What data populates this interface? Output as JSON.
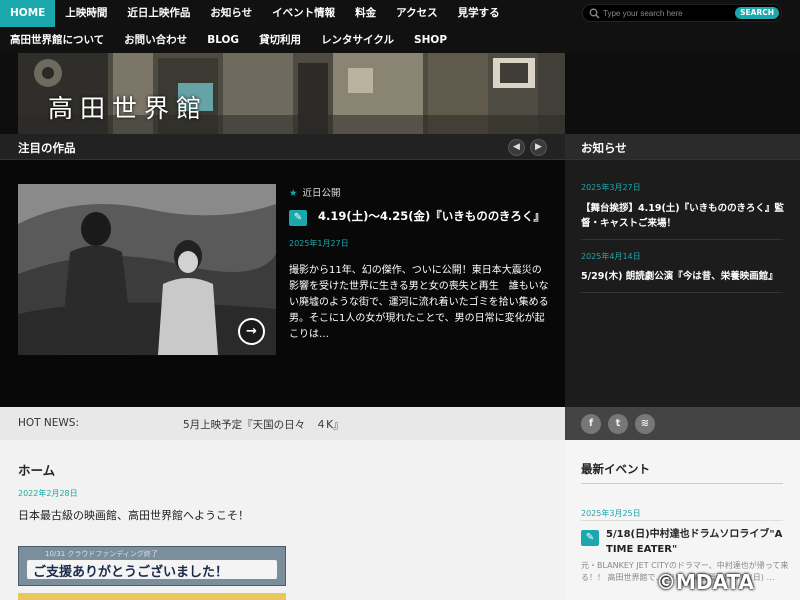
{
  "nav": {
    "row1": [
      "HOME",
      "上映時間",
      "近日上映作品",
      "お知らせ",
      "イベント情報",
      "料金",
      "アクセス",
      "見学する"
    ],
    "row2": [
      "高田世界館について",
      "お問い合わせ",
      "BLOG",
      "貸切利用",
      "レンタサイクル",
      "SHOP"
    ]
  },
  "search": {
    "placeholder": "Type your search here",
    "button": "SEARCH"
  },
  "banner": {
    "title": "高田世界館"
  },
  "featured": {
    "heading": "注目の作品",
    "category": "近日公開",
    "title": "4.19(土)〜4.25(金)『いきもののきろく』",
    "date": "2025年1月27日",
    "excerpt": "撮影から11年、幻の傑作、ついに公開！東日本大震災の影響を受けた世界に生きる男と女の喪失と再生　誰もいない廃墟のような街で、運河に流れ着いたゴミを拾い集める男。そこに1人の女が現れたことで、男の日常に変化が起こりは…"
  },
  "news": {
    "heading": "お知らせ",
    "items": [
      {
        "date": "2025年3月27日",
        "title": "【舞台挨拶】4.19(土)『いきもののきろく』監督・キャストご来場！"
      },
      {
        "date": "2025年4月14日",
        "title": "5/29(木) 朗読劇公演『今は昔、栄養映画館』"
      }
    ]
  },
  "hot": {
    "label": "HOT NEWS:",
    "text": "5月上映予定『天国の日々　４K』"
  },
  "social": {
    "icons": [
      "facebook-icon",
      "twitter-icon",
      "rss-icon"
    ],
    "glyphs": [
      "f",
      "t",
      "≋"
    ]
  },
  "main": {
    "title": "ホーム",
    "date": "2022年2月28日",
    "welcome": "日本最古級の映画館、高田世界館へようこそ！",
    "cf_small": "10/31 クラウドファンディング終了",
    "cf_big": "ご支援ありがとうございました！"
  },
  "events": {
    "heading": "最新イベント",
    "date": "2025年3月25日",
    "title": "5/18(日)中村達也ドラムソロライブ\"A TIME EATER\"",
    "excerpt": "元・BLANKEY JET CITYのドラマー、中村達也が帰って来る！！ 高田世界館で…定!!! 【開催概要】5/18(日) …"
  },
  "watermark": "©MDATA",
  "colors": {
    "accent": "#1aa8ac"
  }
}
